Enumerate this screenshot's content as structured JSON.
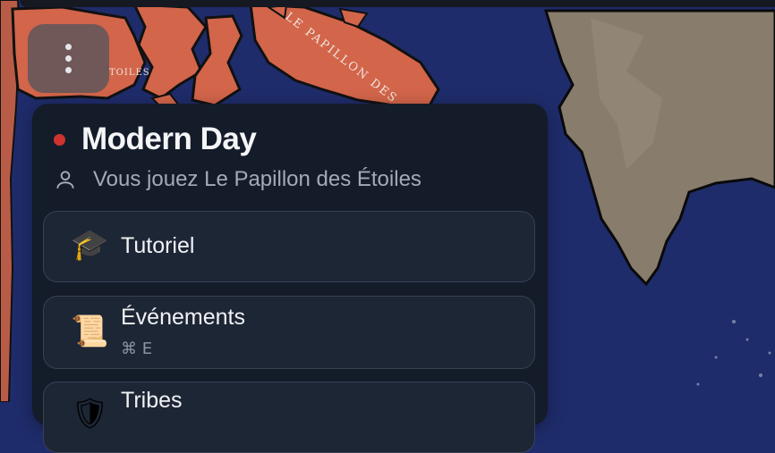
{
  "map": {
    "labels": [
      "LE PAPILLON DES",
      "TOILES"
    ],
    "colors": {
      "ocean": "#1f2c6b",
      "territory": "#d2654a",
      "ice": "#887c6d"
    }
  },
  "menu_button": {
    "icon": "vertical-dots-icon"
  },
  "panel": {
    "status_color": "#d0332f",
    "title": "Modern Day",
    "user_icon": "user-icon",
    "subtitle": "Vous jouez Le Papillon des Étoiles",
    "items": [
      {
        "icon": "🎓",
        "icon_name": "graduation-cap-icon",
        "label": "Tutoriel"
      },
      {
        "icon": "📜",
        "icon_name": "scroll-icon",
        "label": "Événements",
        "shortcut": "⌘ E"
      },
      {
        "icon": "🛡",
        "icon_name": "shield-icon",
        "label": "Tribes"
      }
    ]
  }
}
